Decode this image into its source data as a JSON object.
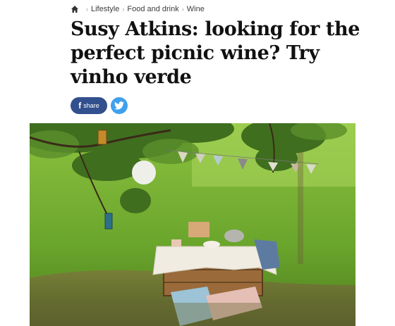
{
  "breadcrumb": {
    "items": [
      "Lifestyle",
      "Food and drink",
      "Wine"
    ]
  },
  "article": {
    "headline": "Susy Atkins: looking for the perfect picnic wine? Try vinho verde"
  },
  "share": {
    "facebook_label": "share",
    "facebook_icon": "f"
  },
  "colors": {
    "facebook": "#32508e",
    "twitter": "#3fa0ee"
  }
}
